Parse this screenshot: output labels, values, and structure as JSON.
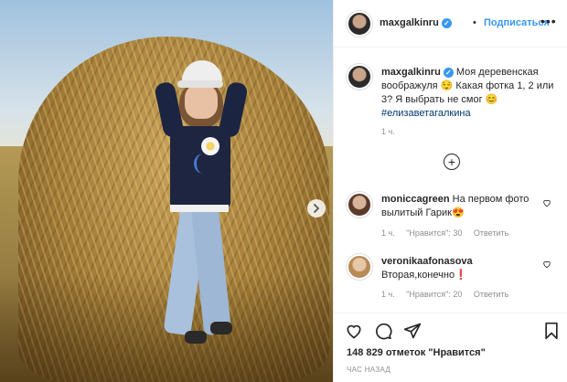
{
  "post": {
    "author": "maxgalkinru",
    "follow_label": "Подписаться",
    "separator": "•",
    "more": "•••",
    "caption_text": "Моя деревенская воображуля 😌 Какая фотка 1, 2 или 3? Я выбрать не смог 😊",
    "hashtag": "#елизаветагалкина",
    "caption_time": "1 ч.",
    "load_more": "+"
  },
  "comments": [
    {
      "username": "moniccagreen",
      "text": "На первом фото вылитый Гарик😍",
      "time": "1 ч.",
      "likes_label": "\"Нравится\": 30",
      "reply_label": "Ответить"
    },
    {
      "username": "veronikaafonasova",
      "text": "Вторая,конечно❗",
      "time": "1 ч.",
      "likes_label": "\"Нравится\": 20",
      "reply_label": "Ответить"
    }
  ],
  "footer": {
    "likes": "148 829 отметок \"Нравится\"",
    "posted": "ЧАС НАЗАД"
  },
  "colors": {
    "accent": "#3897f0",
    "text": "#262626",
    "muted": "#8e8e8e",
    "hashtag": "#00376b"
  }
}
